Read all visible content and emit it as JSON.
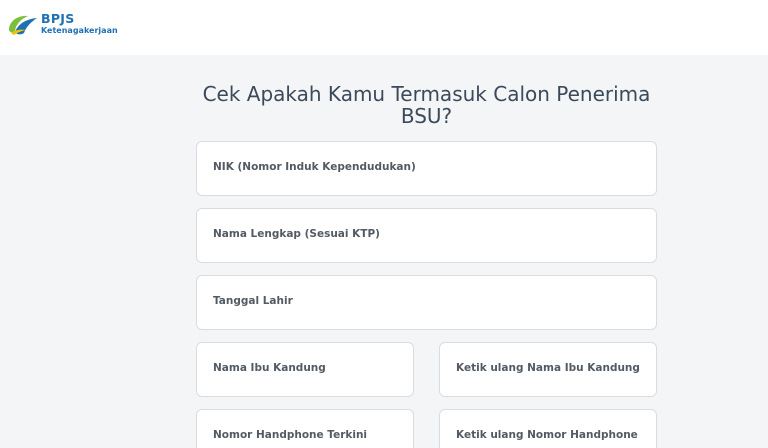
{
  "brand": {
    "name": "BPJS",
    "subtitle": "Ketenagakerjaan",
    "colors": {
      "blue": "#1f70b3",
      "green": "#7cbf3c"
    }
  },
  "page": {
    "title": "Cek Apakah Kamu Termasuk Calon Penerima BSU?"
  },
  "form": {
    "fields": [
      {
        "label": "NIK (Nomor Induk Kependudukan)"
      },
      {
        "label": "Nama Lengkap (Sesuai KTP)"
      },
      {
        "label": "Tanggal Lahir"
      },
      {
        "label": "Nama Ibu Kandung"
      },
      {
        "label": "Ketik ulang Nama Ibu Kandung"
      },
      {
        "label": "Nomor Handphone Terkini"
      },
      {
        "label": "Ketik ulang Nomor Handphone"
      }
    ]
  }
}
